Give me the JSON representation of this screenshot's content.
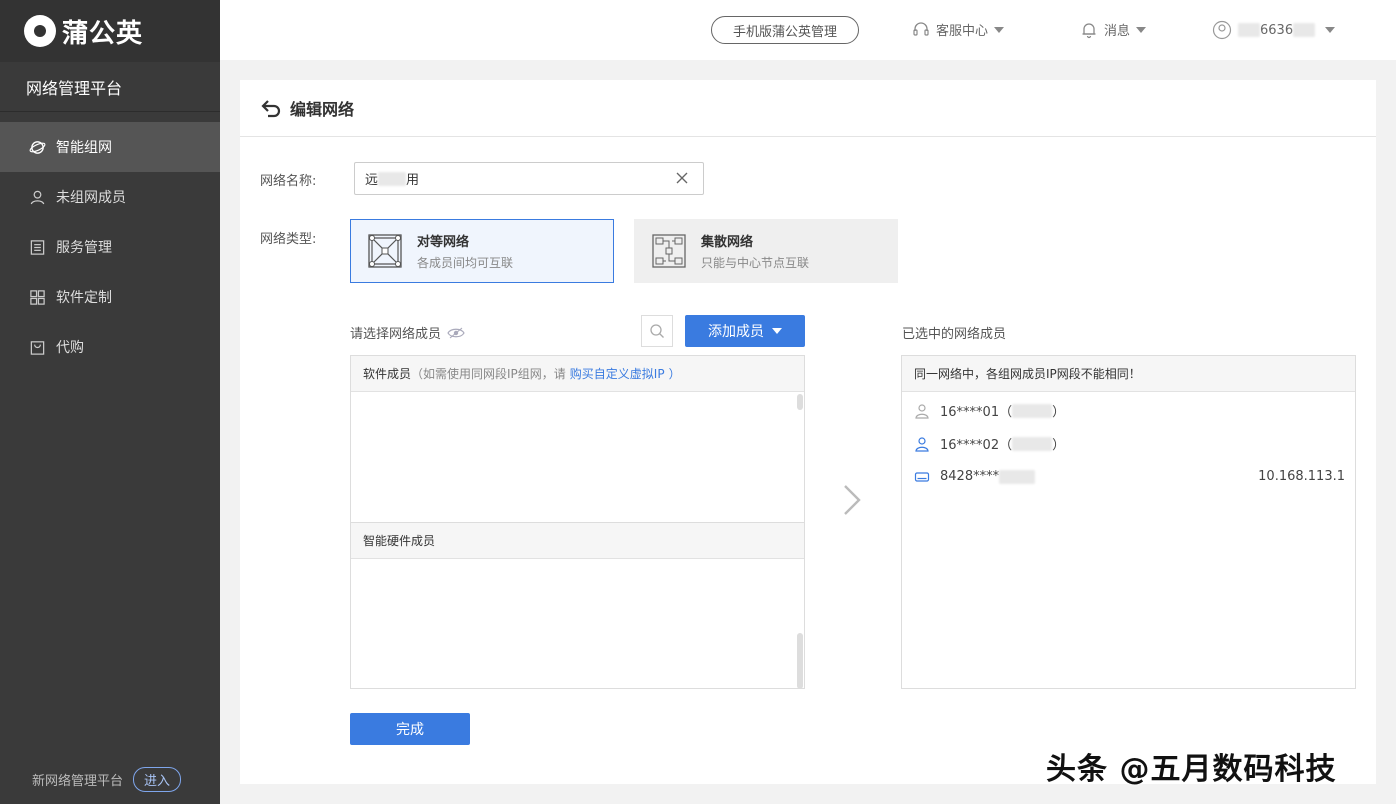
{
  "sidebar": {
    "logo_text": "蒲公英",
    "platform_title": "网络管理平台",
    "items": [
      {
        "label": "智能组网",
        "icon": "planet-icon",
        "active": true
      },
      {
        "label": "未组网成员",
        "icon": "user-icon",
        "active": false
      },
      {
        "label": "服务管理",
        "icon": "list-icon",
        "active": false
      },
      {
        "label": "软件定制",
        "icon": "grid-icon",
        "active": false
      },
      {
        "label": "代购",
        "icon": "bag-icon",
        "active": false
      }
    ],
    "new_platform_label": "新网络管理平台",
    "enter_label": "进入"
  },
  "topbar": {
    "mobile_label": "手机版蒲公英管理",
    "support_label": "客服中心",
    "messages_label": "消息",
    "account_label": "6636"
  },
  "page": {
    "title": "编辑网络",
    "name_label": "网络名称:",
    "name_prefix": "远",
    "name_suffix": "用",
    "type_label": "网络类型:",
    "types": [
      {
        "title": "对等网络",
        "desc": "各成员间均可互联",
        "selected": true
      },
      {
        "title": "集散网络",
        "desc": "只能与中心节点互联",
        "selected": false
      }
    ]
  },
  "members": {
    "select_label": "请选择网络成员",
    "add_label": "添加成员",
    "software_head": "软件成员",
    "software_note_a": "（如需使用同网段IP组网，请",
    "software_link": "购买自定义虚拟IP",
    "software_note_b": "）",
    "hardware_head": "智能硬件成员",
    "selected_label": "已选中的网络成员",
    "selected_notice": "同一网络中，各组网成员IP网段不能相同！",
    "selected": [
      {
        "name": "16****01（",
        "close": "）",
        "ip": "",
        "icon": "user-icon-gray"
      },
      {
        "name": "16****02（",
        "close": "）",
        "ip": "",
        "icon": "user-icon-blue"
      },
      {
        "name": "8428****",
        "close": "",
        "ip": "10.168.113.1",
        "icon": "router-icon"
      }
    ]
  },
  "footer": {
    "done_label": "完成"
  },
  "watermark": "头条 @五月数码科技",
  "colors": {
    "accent": "#3a7be0",
    "sidebar_bg": "#3a3a3a"
  }
}
